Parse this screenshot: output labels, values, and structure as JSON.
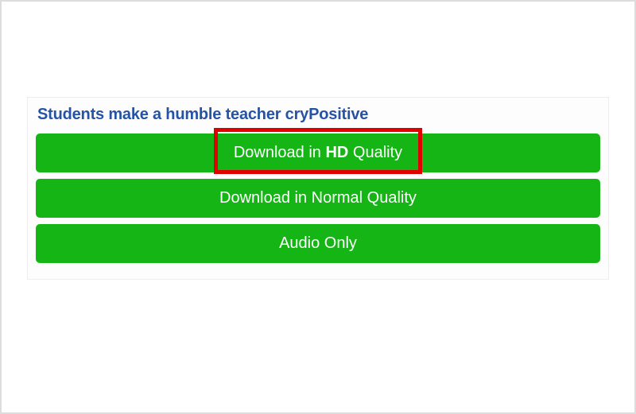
{
  "video": {
    "title": "Students make a humble teacher cryPositive"
  },
  "buttons": {
    "hd": {
      "prefix": "Download in ",
      "bold": "HD",
      "suffix": " Quality"
    },
    "normal_label": "Download in Normal Quality",
    "audio_label": "Audio Only"
  }
}
